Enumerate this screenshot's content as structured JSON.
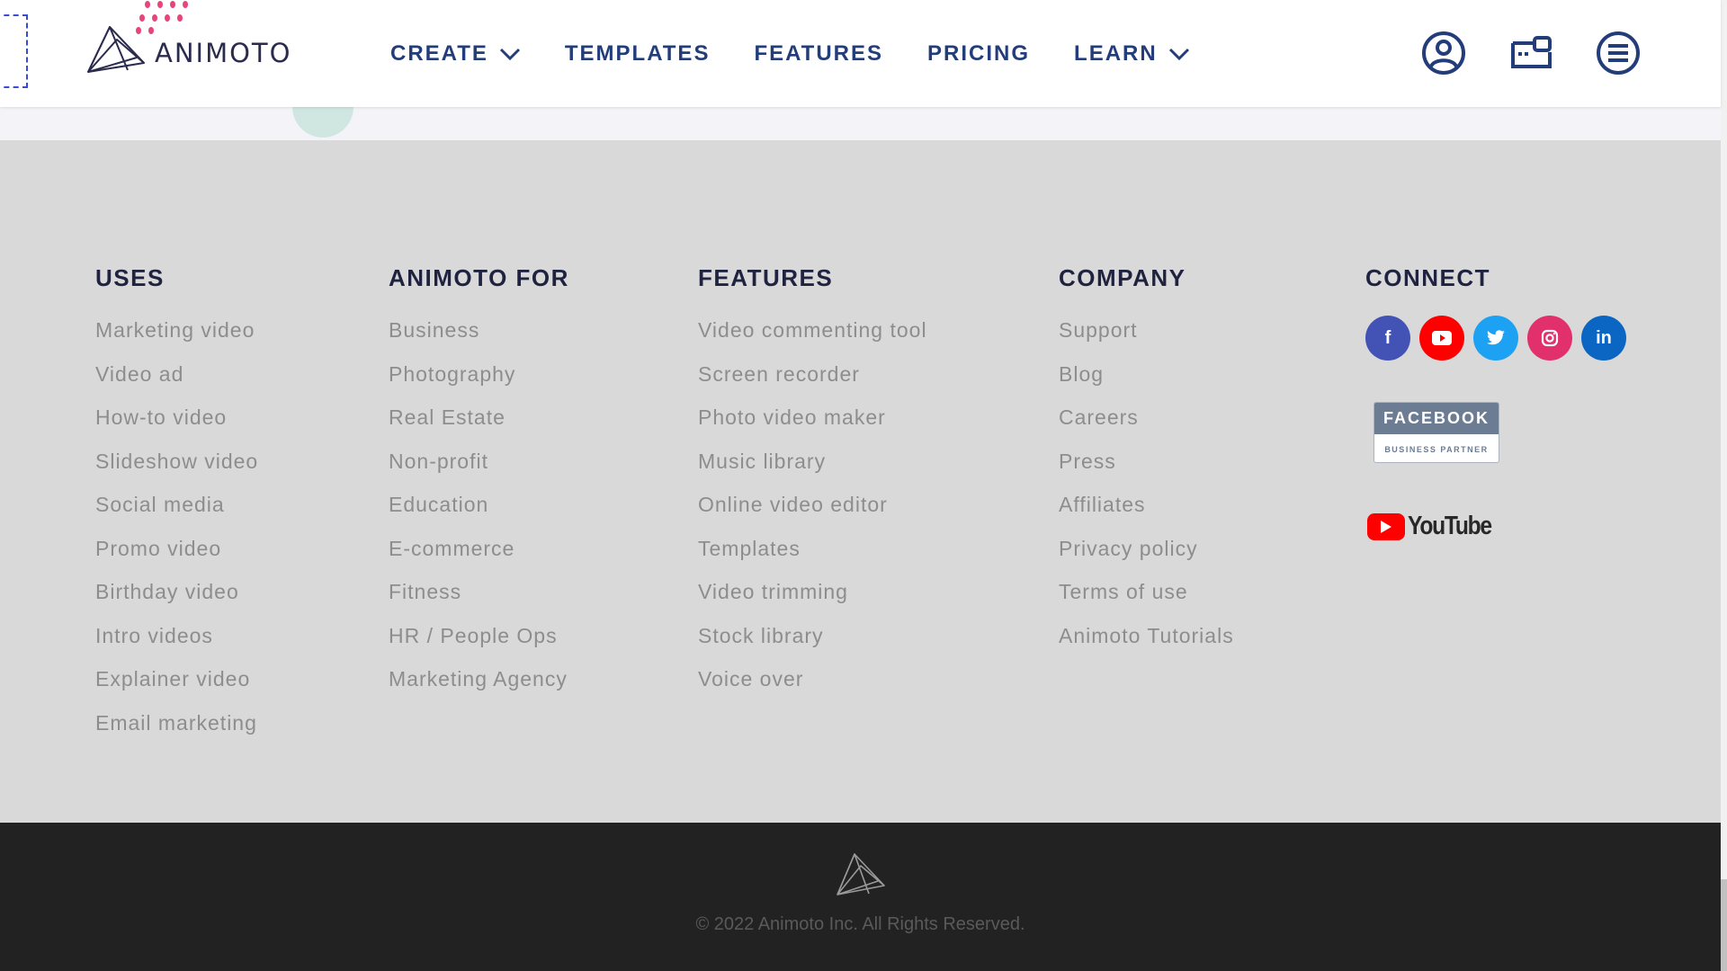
{
  "header": {
    "logo_text": "ANIMOTO",
    "nav": [
      {
        "label": "CREATE",
        "dropdown": true
      },
      {
        "label": "TEMPLATES",
        "dropdown": false
      },
      {
        "label": "FEATURES",
        "dropdown": false
      },
      {
        "label": "PRICING",
        "dropdown": false
      },
      {
        "label": "LEARN",
        "dropdown": true
      }
    ],
    "icons": [
      "account-icon",
      "workspace-icon",
      "menu-icon"
    ],
    "accent_color": "#233c7a"
  },
  "footer": {
    "columns": [
      {
        "heading": "USES",
        "items": [
          "Marketing video",
          "Video ad",
          "How-to video",
          "Slideshow video",
          "Social media",
          "Promo video",
          "Birthday video",
          "Intro videos",
          "Explainer video",
          "Email marketing"
        ]
      },
      {
        "heading": "ANIMOTO FOR",
        "items": [
          "Business",
          "Photography",
          "Real Estate",
          "Non-profit",
          "Education",
          "E-commerce",
          "Fitness",
          "HR / People Ops",
          "Marketing Agency"
        ]
      },
      {
        "heading": "FEATURES",
        "items": [
          "Video commenting tool",
          "Screen recorder",
          "Photo video maker",
          "Music library",
          "Online video editor",
          "Templates",
          "Video trimming",
          "Stock library",
          "Voice over"
        ]
      },
      {
        "heading": "COMPANY",
        "items": [
          "Support",
          "Blog",
          "Careers",
          "Press",
          "Affiliates",
          "Privacy policy",
          "Terms of use",
          "Animoto Tutorials"
        ]
      }
    ],
    "connect": {
      "heading": "CONNECT",
      "social": [
        {
          "icon": "facebook-icon",
          "glyph": "f",
          "color": "#4353b5"
        },
        {
          "icon": "youtube-icon",
          "glyph": "▶",
          "color": "#ff0000"
        },
        {
          "icon": "twitter-icon",
          "glyph": "t",
          "color": "#1da1f2"
        },
        {
          "icon": "instagram-icon",
          "glyph": "◎",
          "color": "#e1306c"
        },
        {
          "icon": "linkedin-icon",
          "glyph": "in",
          "color": "#0a66c2"
        }
      ],
      "fb_badge_top": "FACEBOOK",
      "fb_badge_bottom": "BUSINESS PARTNER",
      "youtube_word": "YouTube"
    },
    "copyright": "© 2022 Animoto Inc. All Rights Reserved."
  }
}
